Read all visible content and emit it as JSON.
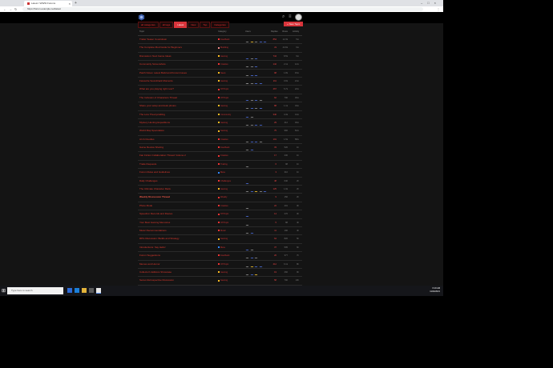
{
  "browser": {
    "tab_title": "Latest / WWW Forums",
    "url": "https://forum.example.net/latest"
  },
  "nav": {
    "pills": [
      {
        "label": "all categories",
        "active": false
      },
      {
        "label": "all tags",
        "active": false
      },
      {
        "label": "Latest",
        "active": true
      },
      {
        "label": "New",
        "active": false
      },
      {
        "label": "Top",
        "active": false
      },
      {
        "label": "Categories",
        "active": false
      }
    ],
    "new_topic": "+ New Topic"
  },
  "columns": {
    "topic": "Topic",
    "category": "Category",
    "users": "Users",
    "replies": "Replies",
    "views": "Views",
    "activity": "Activity"
  },
  "topics": [
    {
      "title": "Trailer Teaser Countdown",
      "category": "Feedback",
      "cat_color": "#e33",
      "replies": "854",
      "views": "12.3k",
      "activity": "5m"
    },
    {
      "title": "The Complete Mod Guide for Beginners",
      "category": "Modding",
      "cat_color": "#e88",
      "replies": "2k",
      "views": "44.6k",
      "activity": "6m"
    },
    {
      "title": "Discussion: Next Game Ideas",
      "category": "Gaming",
      "cat_color": "#fb2",
      "replies": "744",
      "views": "8.5k",
      "activity": "9m"
    },
    {
      "title": "Community Screenshots",
      "category": "Creative",
      "cat_color": "#e33",
      "replies": "142",
      "views": "2.1k",
      "activity": "12m"
    },
    {
      "title": "Patch Notes: Latest Build and Known Issues",
      "category": "News",
      "cat_color": "#fb2",
      "replies": "98",
      "views": "1.8k",
      "activity": "15m"
    },
    {
      "title": "Favourite Soundtrack Moments",
      "category": "Gaming",
      "cat_color": "#fb2",
      "replies": "211",
      "views": "3.0k",
      "activity": "21m"
    },
    {
      "title": "What are you playing right now?",
      "category": "Off Topic",
      "cat_color": "#e33",
      "replies": "467",
      "views": "5.7k",
      "activity": "22m"
    },
    {
      "title": "The Inclusion of Characters Thread",
      "category": "Off Topic",
      "cat_color": "#e33",
      "replies": "62",
      "views": "790",
      "activity": "30m"
    },
    {
      "title": "Share your setup and desk photos",
      "category": "Gaming",
      "cat_color": "#fb2",
      "replies": "88",
      "views": "1.1k",
      "activity": "34m"
    },
    {
      "title": "The Lore Theorycrafting",
      "category": "Community",
      "cat_color": "#fb2",
      "replies": "340",
      "views": "4.4k",
      "activity": "41m"
    },
    {
      "title": "Mystery Hunting Expeditions",
      "category": "Gaming",
      "cat_color": "#fb2",
      "replies": "29",
      "views": "412",
      "activity": "49m"
    },
    {
      "title": "World Map Speculation",
      "category": "Gaming",
      "cat_color": "#fb2",
      "replies": "75",
      "views": "960",
      "activity": "52m"
    },
    {
      "title": "Art & Doodles",
      "category": "Creative",
      "cat_color": "#e33",
      "replies": "101",
      "views": "1.5k",
      "activity": "58m"
    },
    {
      "title": "Game Review Sharing",
      "category": "Feedback",
      "cat_color": "#e33",
      "replies": "33",
      "views": "520",
      "activity": "1h"
    },
    {
      "title": "Fan Fiction Collaboration Thread: Volume 2",
      "category": "Creative",
      "cat_color": "#e33",
      "replies": "17",
      "views": "230",
      "activity": "1h"
    },
    {
      "title": "Trade Requests",
      "category": "Trading",
      "cat_color": "#e33",
      "replies": "6",
      "views": "98",
      "activity": "1h"
    },
    {
      "title": "Forum Rules and Guidelines",
      "category": "Meta",
      "cat_color": "#38f",
      "replies": "3",
      "views": "310",
      "activity": "1h"
    },
    {
      "title": "Daily Challenges",
      "category": "Challenges",
      "cat_color": "#e33",
      "replies": "48",
      "views": "640",
      "activity": "2h"
    },
    {
      "title": "The Ultimate Character Rank",
      "category": "Gaming",
      "cat_color": "#fb2",
      "replies": "125",
      "views": "1.9k",
      "activity": "2h"
    },
    {
      "title": "Weekly Discussion Thread",
      "category": "Weekly",
      "cat_color": "#e33",
      "replies": "9",
      "views": "150",
      "activity": "2h",
      "highlight": true
    },
    {
      "title": "Photo Mode",
      "category": "Creative",
      "cat_color": "#e33",
      "replies": "22",
      "views": "401",
      "activity": "3h"
    },
    {
      "title": "Speedrun Records and Routes",
      "category": "Off Topic",
      "cat_color": "#e33",
      "replies": "14",
      "views": "276",
      "activity": "3h"
    },
    {
      "title": "Your Best Gaming Memories",
      "category": "Off Topic",
      "cat_color": "#e33",
      "replies": "5",
      "views": "88",
      "activity": "4h"
    },
    {
      "title": "Music Recommendations",
      "category": "Music",
      "cat_color": "#e33",
      "replies": "11",
      "views": "190",
      "activity": "4h"
    },
    {
      "title": "RPG Discussion: Builds and Strategy",
      "category": "Gaming",
      "cat_color": "#fb2",
      "replies": "64",
      "views": "820",
      "activity": "5h"
    },
    {
      "title": "Introductions: Say Hello!",
      "category": "Meta",
      "cat_color": "#38f",
      "replies": "37",
      "views": "505",
      "activity": "6h"
    },
    {
      "title": "Forum Suggestions",
      "category": "Feedback",
      "cat_color": "#e33",
      "replies": "26",
      "views": "377",
      "activity": "7h"
    },
    {
      "title": "Memes and Humor",
      "category": "Off Topic",
      "cat_color": "#e33",
      "replies": "412",
      "views": "6.1k",
      "activity": "8h"
    },
    {
      "title": "Collector's Editions Showcase",
      "category": "Gaming",
      "cat_color": "#fb2",
      "replies": "19",
      "views": "260",
      "activity": "9h"
    },
    {
      "title": "Series Retrospective Discussion",
      "category": "Gaming",
      "cat_color": "#fb2",
      "replies": "58",
      "views": "790",
      "activity": "10h"
    }
  ],
  "taskbar": {
    "search_placeholder": "Type here to search",
    "time": "6:19 AM",
    "date": "11/24/2021"
  }
}
